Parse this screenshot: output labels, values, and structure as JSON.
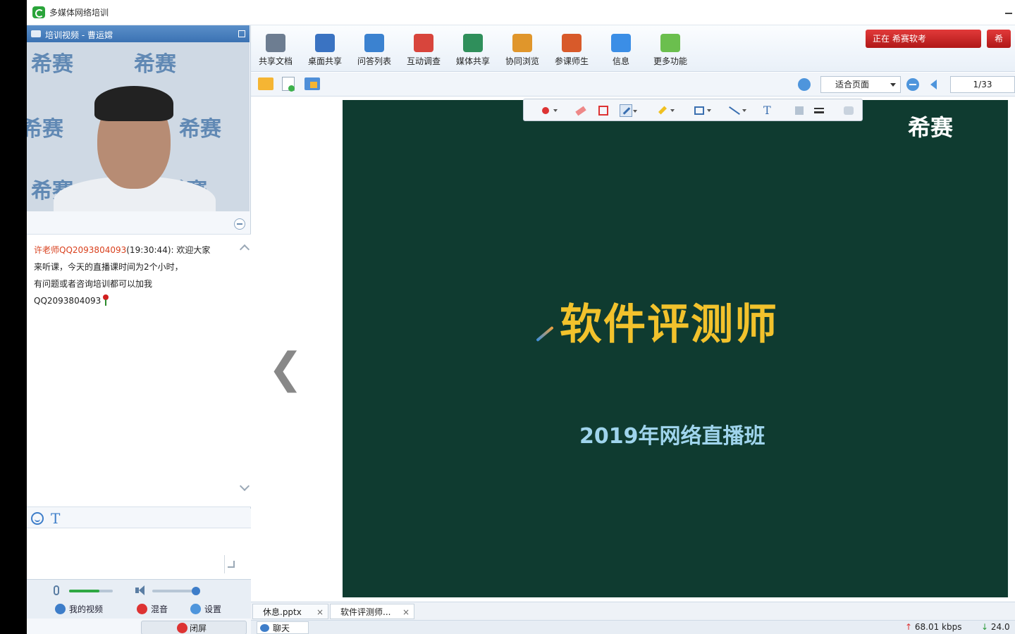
{
  "window": {
    "title": "多媒体网络培训"
  },
  "video_panel": {
    "header": "培训视频 - 曹运嫦",
    "watermarks": [
      "希赛",
      "希赛",
      "希赛",
      "希赛",
      "希赛",
      "希赛"
    ]
  },
  "chat": {
    "sender": "许老师QQ2093804093",
    "time": "(19:30:44):",
    "message_line1": "欢迎大家",
    "message_line2": "来听课，今天的直播课时间为2个小时，",
    "message_line3": "有问题或者咨询培训都可以加我",
    "message_line4": "QQ2093804093"
  },
  "controls": {
    "mic_level_percent": 70,
    "speaker_level_percent": 100,
    "my_video": "我的视频",
    "mute": "混音",
    "settings": "设置",
    "close": "闭屏"
  },
  "toolbar": {
    "items": [
      {
        "label": "共享文档",
        "icon": "document-share-icon",
        "color": "#6d7d91"
      },
      {
        "label": "桌面共享",
        "icon": "desktop-share-icon",
        "color": "#3a73c2"
      },
      {
        "label": "问答列表",
        "icon": "qa-list-icon",
        "color": "#3b82d0"
      },
      {
        "label": "互动调查",
        "icon": "survey-chart-icon",
        "color": "#d8453c"
      },
      {
        "label": "媒体共享",
        "icon": "media-share-icon",
        "color": "#2f8f5b"
      },
      {
        "label": "协同浏览",
        "icon": "cobrowse-icon",
        "color": "#e0962b"
      },
      {
        "label": "参课师生",
        "icon": "participants-icon",
        "color": "#d85a2a"
      },
      {
        "label": "信息",
        "icon": "info-icon",
        "color": "#3b8ee6"
      },
      {
        "label": "更多功能",
        "icon": "more-apps-icon",
        "color": "#6bbf4e"
      }
    ],
    "brand": "正在 希赛软考",
    "brand2": "希"
  },
  "doc_toolbar": {
    "zoom": "适合页面",
    "page": "1/33"
  },
  "slide": {
    "logo": "希赛",
    "title": "软件评测师",
    "subtitle": "2019年网络直播班",
    "title_color": "#f2c22c",
    "background_color": "#0f3b30"
  },
  "tabs": [
    {
      "label": "休息.pptx"
    },
    {
      "label": "软件评测师..."
    }
  ],
  "status": {
    "chat_tab": "聊天",
    "upload": "68.01 kbps",
    "download": "24.0"
  }
}
